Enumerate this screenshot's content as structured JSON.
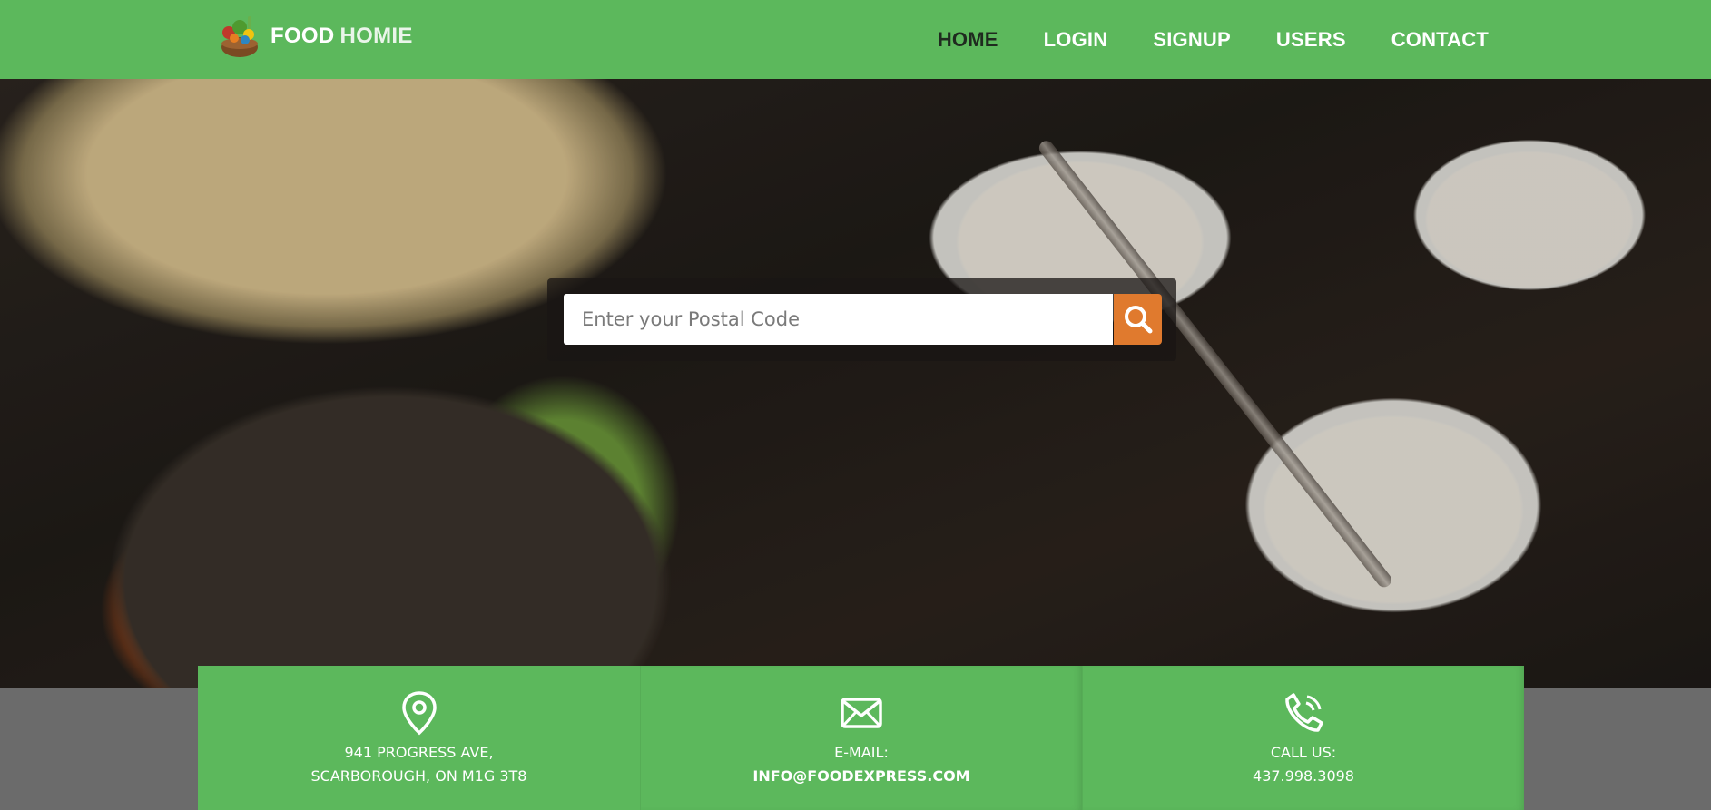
{
  "brand": {
    "name_part1": "FOOD",
    "name_part2": "HOMIE"
  },
  "nav": {
    "items": [
      {
        "label": "HOME",
        "active": true
      },
      {
        "label": "LOGIN"
      },
      {
        "label": "SIGNUP"
      },
      {
        "label": "USERS"
      },
      {
        "label": "CONTACT"
      }
    ]
  },
  "search": {
    "placeholder": "Enter your Postal Code",
    "icon": "search-icon"
  },
  "contacts": [
    {
      "icon": "map-pin-icon",
      "line1": "941 PROGRESS AVE,",
      "line2": "SCARBOROUGH, ON M1G 3T8"
    },
    {
      "icon": "envelope-icon",
      "line1": "E-MAIL:",
      "line2": "INFO@FOODEXPRESS.COM"
    },
    {
      "icon": "phone-icon",
      "line1": "CALL US:",
      "line2": "437.998.3098"
    }
  ],
  "colors": {
    "primary_green": "#5cb85c",
    "search_button": "#e07a2e",
    "active_nav": "#1f2a1f"
  }
}
